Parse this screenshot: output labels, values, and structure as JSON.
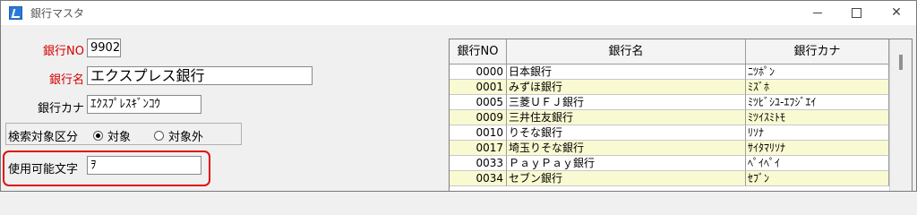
{
  "window": {
    "title": "銀行マスタ",
    "controls": {
      "minimize": "",
      "maximize": "",
      "close": "✕"
    }
  },
  "form": {
    "bank_no": {
      "label": "銀行NO",
      "value": "9902"
    },
    "bank_name": {
      "label": "銀行名",
      "value": "エクスプレス銀行"
    },
    "bank_kana": {
      "label": "銀行カナ",
      "value": "ｴｸｽﾌﾟﾚｽｷﾞﾝｺｳ"
    },
    "search_scope": {
      "label": "検索対象区分",
      "options": [
        {
          "label": "対象",
          "selected": true
        },
        {
          "label": "対象外",
          "selected": false
        }
      ]
    },
    "usable_chars": {
      "label": "使用可能文字",
      "value": "ｦ"
    }
  },
  "grid": {
    "headers": [
      "銀行NO",
      "銀行名",
      "銀行カナ"
    ],
    "row_colors": {
      "odd": "#ffffff",
      "even": "#fafad2"
    },
    "rows": [
      [
        "0000",
        "日本銀行",
        "ﾆﾂﾎﾟﾝ"
      ],
      [
        "0001",
        "みずほ銀行",
        "ﾐｽﾞﾎ"
      ],
      [
        "0005",
        "三菱ＵＦＪ銀行",
        "ﾐﾂﾋﾞｼﾕ-ｴﾌｼﾞｴｲ"
      ],
      [
        "0009",
        "三井住友銀行",
        "ﾐﾂｲｽﾐﾄﾓ"
      ],
      [
        "0010",
        "りそな銀行",
        "ﾘｿﾅ"
      ],
      [
        "0017",
        "埼玉りそな銀行",
        "ｻｲﾀﾏﾘｿﾅ"
      ],
      [
        "0033",
        "ＰａｙＰａｙ銀行",
        "ﾍﾟｲﾍﾟｲ"
      ],
      [
        "0034",
        "セブン銀行",
        "ｾﾌﾞﾝ"
      ]
    ]
  }
}
